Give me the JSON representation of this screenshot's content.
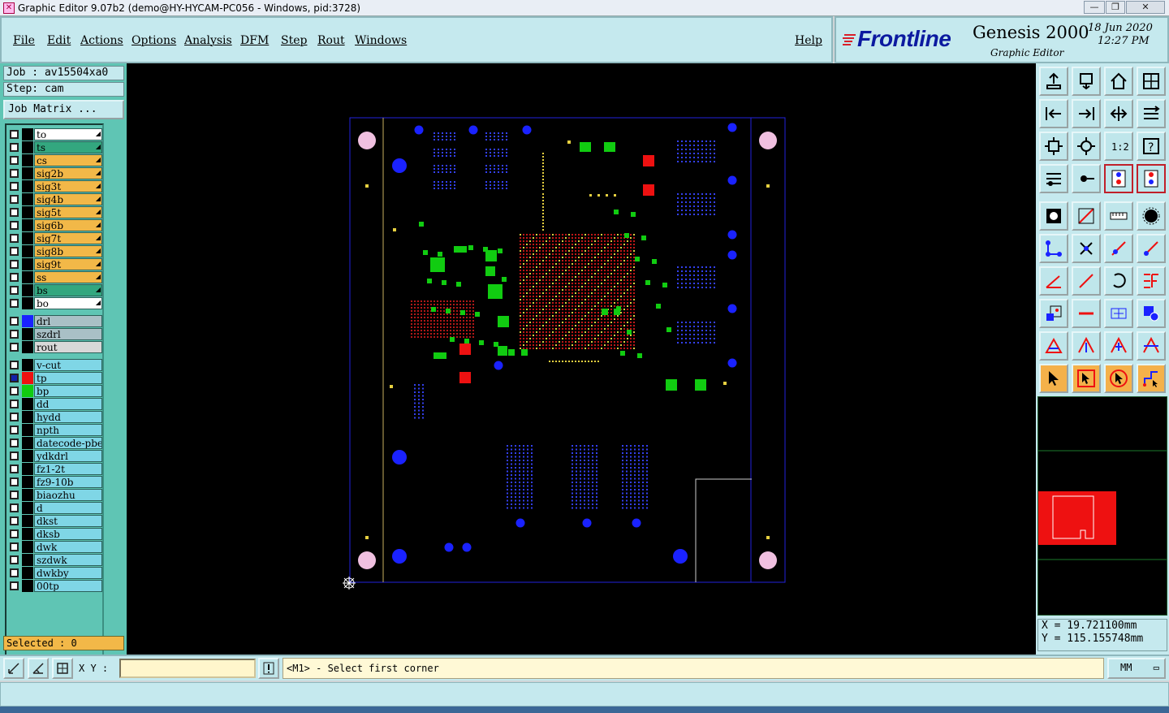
{
  "window": {
    "title": "Graphic Editor 9.07b2 (demo@HY-HYCAM-PC056 - Windows, pid:3728)",
    "minimize": "—",
    "maximize": "❐",
    "close": "✕"
  },
  "menu": {
    "items": [
      "File",
      "Edit",
      "Actions",
      "Options",
      "Analysis",
      "DFM",
      "Step",
      "Rout",
      "Windows"
    ],
    "help": "Help"
  },
  "brand": {
    "logo": "Frontline",
    "product": "Genesis 2000",
    "subtitle": "Graphic Editor",
    "date": "18 Jun 2020",
    "time": "12:27 PM"
  },
  "job": {
    "job_line": "Job : av15504xa0",
    "step_line": "Step: cam",
    "job_matrix": "Job Matrix ..."
  },
  "layers": [
    {
      "name": "to",
      "color": "#ffffff",
      "swatch": "#000000"
    },
    {
      "name": "ts",
      "color": "#33a77f",
      "swatch": "#000000"
    },
    {
      "name": "cs",
      "color": "#f2b848",
      "swatch": "#000000"
    },
    {
      "name": "sig2b",
      "color": "#f2b848",
      "swatch": "#000000"
    },
    {
      "name": "sig3t",
      "color": "#f2b848",
      "swatch": "#000000"
    },
    {
      "name": "sig4b",
      "color": "#f2b848",
      "swatch": "#000000"
    },
    {
      "name": "sig5t",
      "color": "#f2b848",
      "swatch": "#000000"
    },
    {
      "name": "sig6b",
      "color": "#f2b848",
      "swatch": "#000000"
    },
    {
      "name": "sig7t",
      "color": "#f2b848",
      "swatch": "#000000"
    },
    {
      "name": "sig8b",
      "color": "#f2b848",
      "swatch": "#000000"
    },
    {
      "name": "sig9t",
      "color": "#f2b848",
      "swatch": "#000000"
    },
    {
      "name": "ss",
      "color": "#f2b848",
      "swatch": "#000000"
    },
    {
      "name": "bs",
      "color": "#33a77f",
      "swatch": "#000000"
    },
    {
      "name": "bo",
      "color": "#ffffff",
      "swatch": "#000000"
    },
    {
      "name": "drl",
      "color": "#a9c0c6",
      "swatch": "#1a22ff"
    },
    {
      "name": "szdrl",
      "color": "#a9c0c6",
      "swatch": "#000000"
    },
    {
      "name": "rout",
      "color": "#d8d8d8",
      "swatch": "#000000"
    },
    {
      "name": "v-cut",
      "color": "#7fd6e6",
      "swatch": "#000000"
    },
    {
      "name": "tp",
      "color": "#7fd6e6",
      "swatch": "#ee1111"
    },
    {
      "name": "bp",
      "color": "#7fd6e6",
      "swatch": "#11cc11"
    },
    {
      "name": "dd",
      "color": "#7fd6e6",
      "swatch": "#000000"
    },
    {
      "name": "hydd",
      "color": "#7fd6e6",
      "swatch": "#000000"
    },
    {
      "name": "npth",
      "color": "#7fd6e6",
      "swatch": "#000000"
    },
    {
      "name": "datecode-pbe",
      "color": "#7fd6e6",
      "swatch": "#000000"
    },
    {
      "name": "ydkdrl",
      "color": "#7fd6e6",
      "swatch": "#000000"
    },
    {
      "name": "fz1-2t",
      "color": "#7fd6e6",
      "swatch": "#000000"
    },
    {
      "name": "fz9-10b",
      "color": "#7fd6e6",
      "swatch": "#000000"
    },
    {
      "name": "biaozhu",
      "color": "#7fd6e6",
      "swatch": "#000000"
    },
    {
      "name": "d",
      "color": "#7fd6e6",
      "swatch": "#000000"
    },
    {
      "name": "dkst",
      "color": "#7fd6e6",
      "swatch": "#000000"
    },
    {
      "name": "dksb",
      "color": "#7fd6e6",
      "swatch": "#000000"
    },
    {
      "name": "dwk",
      "color": "#7fd6e6",
      "swatch": "#000000"
    },
    {
      "name": "szdwk",
      "color": "#7fd6e6",
      "swatch": "#000000"
    },
    {
      "name": "dwkby",
      "color": "#7fd6e6",
      "swatch": "#000000"
    },
    {
      "name": "00tp",
      "color": "#7fd6e6",
      "swatch": "#000000"
    }
  ],
  "selected": "Selected : 0",
  "coords": {
    "x": "X =  19.721100mm",
    "y": "Y = 115.155748mm"
  },
  "bottom": {
    "xy_label": "X Y :",
    "xy_value": "",
    "message": "<M1> - Select first corner",
    "units": "MM"
  },
  "tools": [
    "open-icon",
    "save-icon",
    "home-icon",
    "window-icon",
    "pan-left-icon",
    "pan-right-icon",
    "zoom-fit-icon",
    "split-icon",
    "zoom-in-icon",
    "zoom-out-icon",
    "scale-icon",
    "help-icon",
    "measure-icon",
    "probe-icon",
    "layers-on-icon",
    "layers-off-icon",
    "pad-icon",
    "line-icon",
    "ruler-icon",
    "dot-icon",
    "connect-icon",
    "cross-icon",
    "node-icon",
    "move-node-icon",
    "angle-icon",
    "slash-icon",
    "rotate-icon",
    "mirror-icon",
    "scale-box-icon",
    "minus-icon",
    "grid-icon",
    "shapes-icon",
    "triangle-icon",
    "triangle-up-icon",
    "arch-icon",
    "arch-line-icon",
    "pointer-icon",
    "select-icon",
    "select-alt-icon",
    "route-icon"
  ],
  "colors": {
    "panel": "#c5e9ee",
    "layer_panel": "#5fc5b4",
    "canvas": "#000000",
    "board_outline": "#2222dd",
    "drill": "#1a22ff",
    "pad_green": "#11cc11",
    "pad_red": "#ee1111"
  }
}
